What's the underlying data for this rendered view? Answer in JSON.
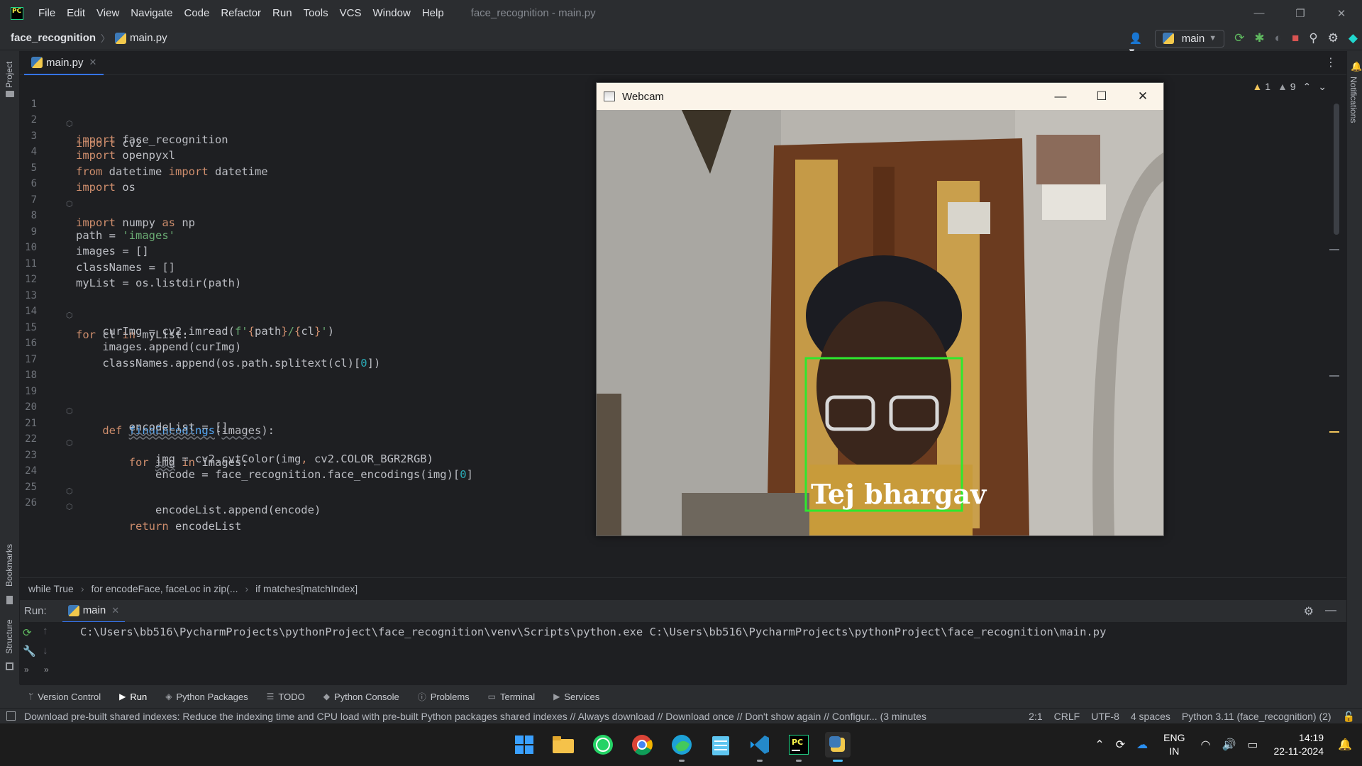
{
  "menubar": {
    "items": [
      "File",
      "Edit",
      "View",
      "Navigate",
      "Code",
      "Refactor",
      "Run",
      "Tools",
      "VCS",
      "Window",
      "Help"
    ],
    "window_title": "face_recognition - main.py"
  },
  "navbar": {
    "project": "face_recognition",
    "file": "main.py",
    "run_config": "main"
  },
  "editor": {
    "tab": "main.py",
    "warnings_count": "1",
    "weak_warnings_count": "9",
    "lines": [
      {
        "n": "1",
        "text": "import cv2"
      },
      {
        "n": "2",
        "text": "import face_recognition"
      },
      {
        "n": "3",
        "text": "import openpyxl"
      },
      {
        "n": "4",
        "text": "from datetime import datetime"
      },
      {
        "n": "5",
        "text": "import os"
      },
      {
        "n": "6",
        "text": "import numpy as np"
      },
      {
        "n": "7",
        "text": ""
      },
      {
        "n": "8",
        "text": "path = 'images'"
      },
      {
        "n": "9",
        "text": "images = []"
      },
      {
        "n": "10",
        "text": "classNames = []"
      },
      {
        "n": "11",
        "text": "myList = os.listdir(path)"
      },
      {
        "n": "12",
        "text": ""
      },
      {
        "n": "13",
        "text": "for cl in myList:"
      },
      {
        "n": "14",
        "text": "    curImg = cv2.imread(f'{path}/{cl}')"
      },
      {
        "n": "15",
        "text": "    images.append(curImg)"
      },
      {
        "n": "16",
        "text": "    classNames.append(os.path.splitext(cl)[0])"
      },
      {
        "n": "17",
        "text": ""
      },
      {
        "n": "18",
        "text": ""
      },
      {
        "n": "19",
        "text": "    def findEncodings(images):"
      },
      {
        "n": "20",
        "text": "        encodeList = []"
      },
      {
        "n": "21",
        "text": "        for img in images:"
      },
      {
        "n": "22",
        "text": "            img = cv2.cvtColor(img, cv2.COLOR_BGR2RGB)"
      },
      {
        "n": "23",
        "text": "            encode = face_recognition.face_encodings(img)[0]"
      },
      {
        "n": "24",
        "text": "            encodeList.append(encode)"
      },
      {
        "n": "25",
        "text": "        return encodeList"
      },
      {
        "n": "26",
        "text": ""
      }
    ],
    "breadcrumbs": [
      "while True",
      "for encodeFace, faceLoc in zip(...",
      "if matches[matchIndex]"
    ]
  },
  "webcam": {
    "title": "Webcam",
    "label": "Tej bhargav"
  },
  "run": {
    "title": "Run:",
    "tab": "main",
    "output": "C:\\Users\\bb516\\PycharmProjects\\pythonProject\\face_recognition\\venv\\Scripts\\python.exe C:\\Users\\bb516\\PycharmProjects\\pythonProject\\face_recognition\\main.py"
  },
  "tool_windows": [
    "Version Control",
    "Run",
    "Python Packages",
    "TODO",
    "Python Console",
    "Problems",
    "Terminal",
    "Services"
  ],
  "side_labels": {
    "project": "Project",
    "bookmarks": "Bookmarks",
    "structure": "Structure",
    "notifications": "Notifications"
  },
  "statusbar": {
    "message": "Download pre-built shared indexes: Reduce the indexing time and CPU load with pre-built Python packages shared indexes // Always download // Download once // Don't show again // Configur... (3 minutes",
    "position": "2:1",
    "line_sep": "CRLF",
    "encoding": "UTF-8",
    "indent": "4 spaces",
    "interpreter": "Python 3.11 (face_recognition) (2)"
  },
  "taskbar": {
    "lang_top": "ENG",
    "lang_bottom": "IN",
    "time": "14:19",
    "date": "22-11-2024"
  },
  "colors": {
    "accent": "#3574f0",
    "face_box": "#2ee82e"
  }
}
